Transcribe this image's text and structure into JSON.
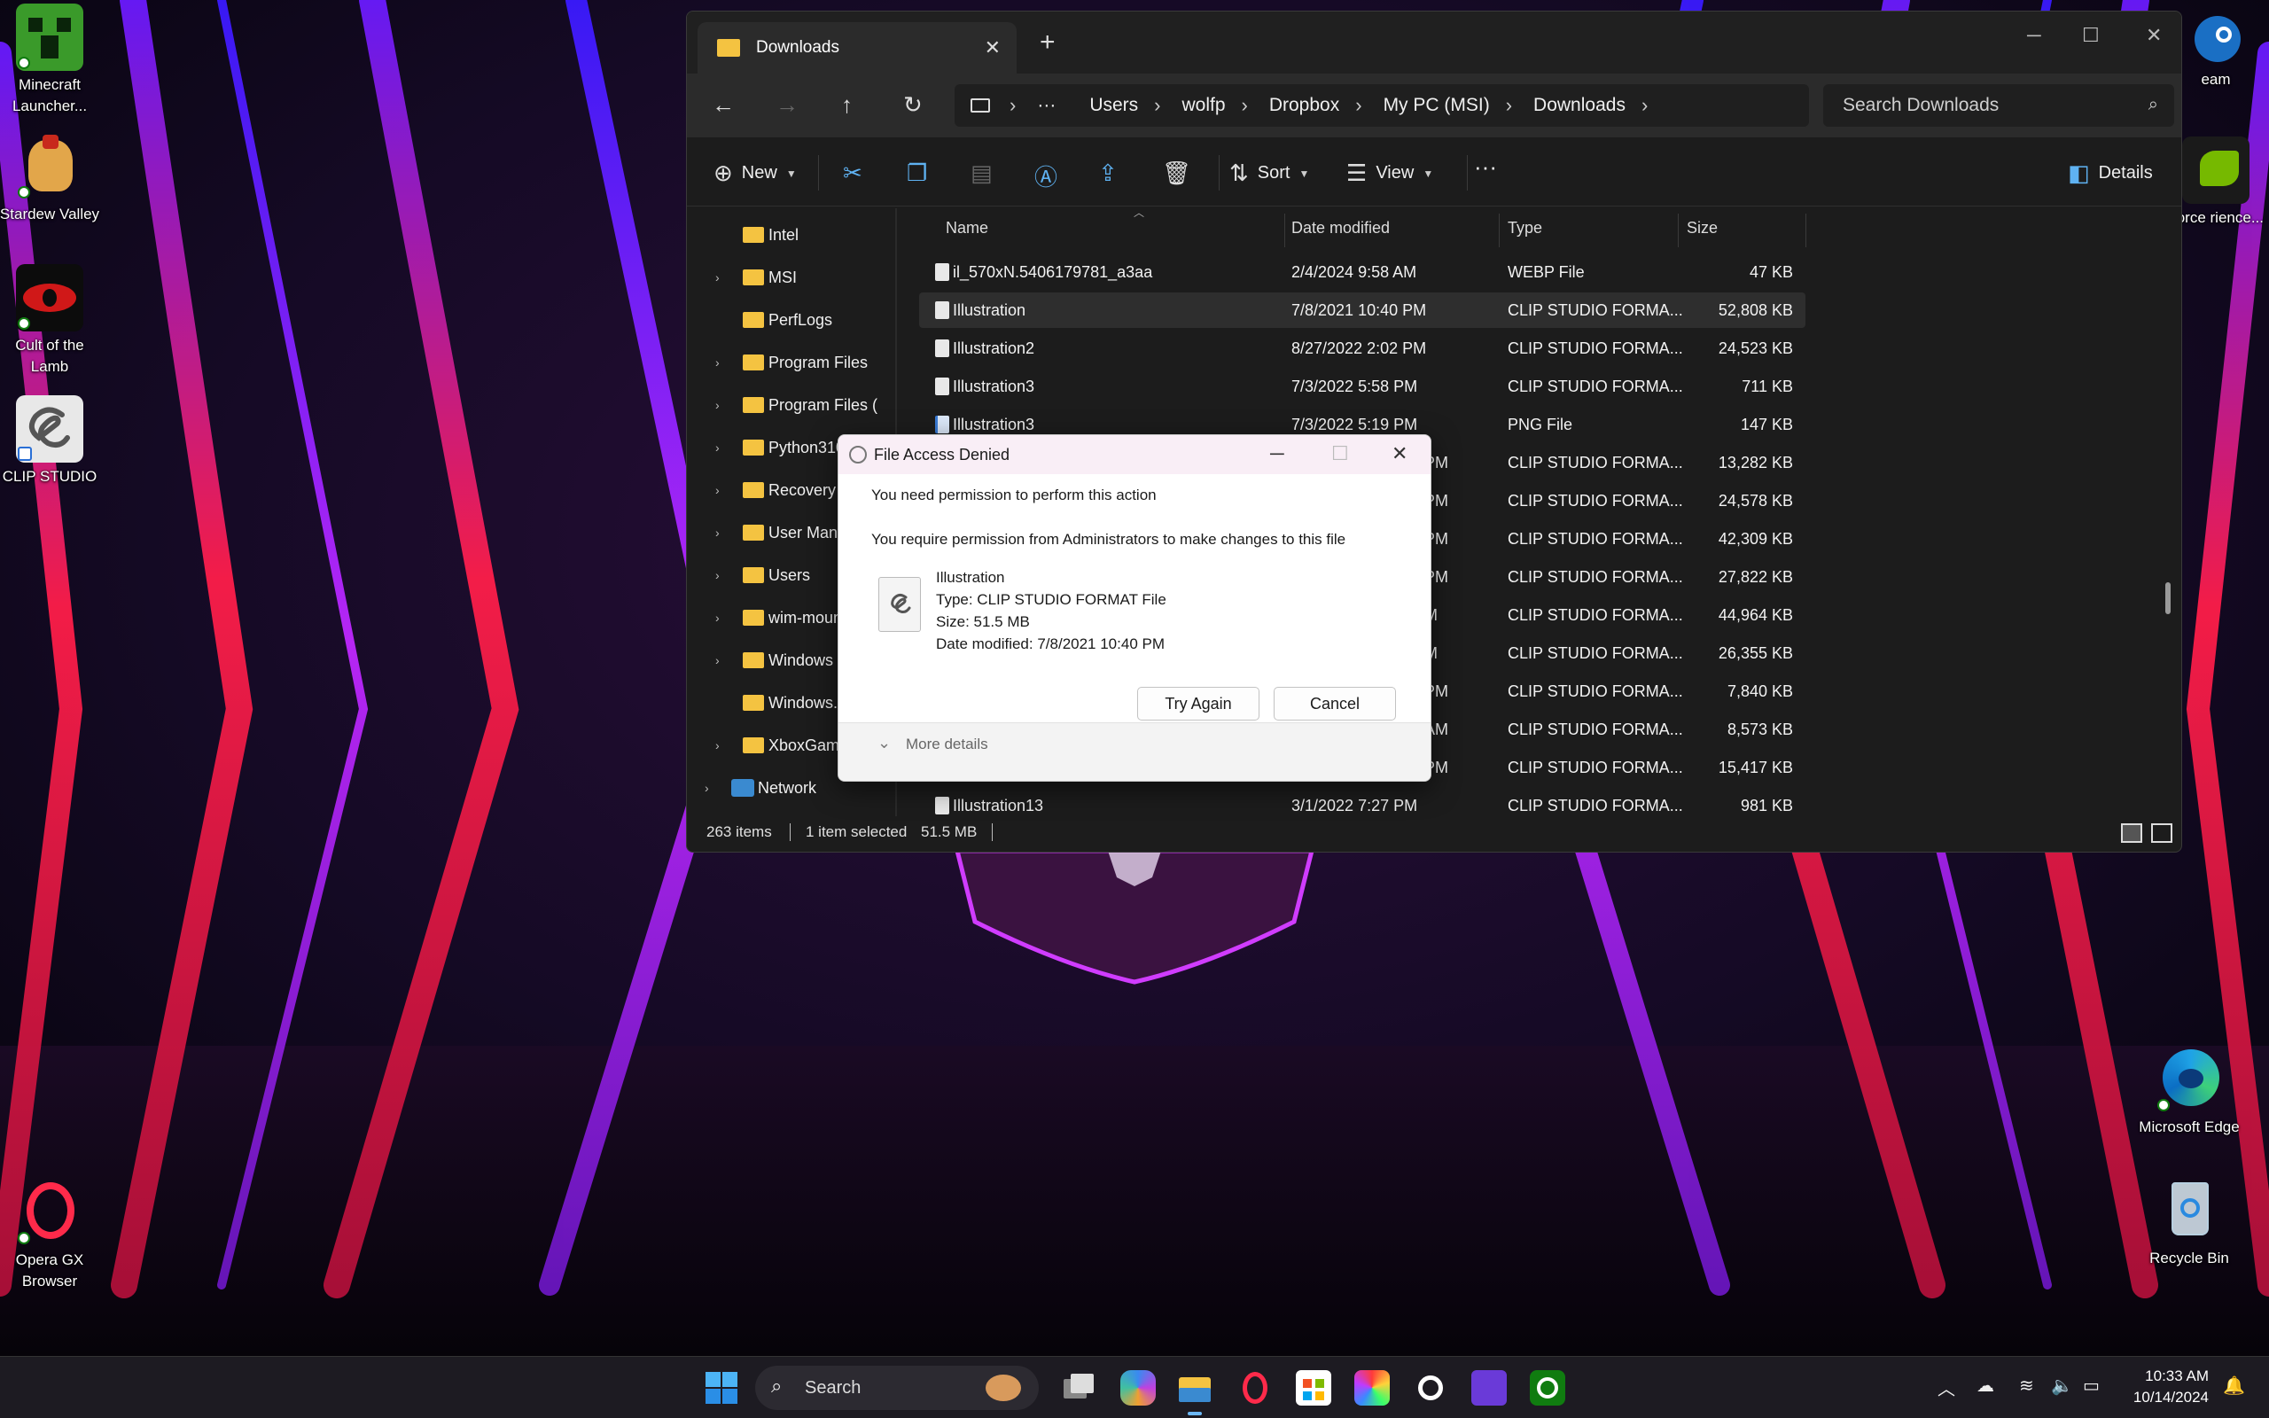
{
  "desktop": {
    "left_icons": [
      {
        "label": "Minecraft Launcher..."
      },
      {
        "label": "Stardew Valley"
      },
      {
        "label": "Cult of the Lamb"
      },
      {
        "label": "CLIP STUDIO"
      },
      {
        "label": "Opera GX Browser"
      }
    ],
    "right_icons": [
      {
        "label": "eam"
      },
      {
        "label": "Force rience..."
      },
      {
        "label": "Microsoft Edge"
      },
      {
        "label": "Recycle Bin"
      }
    ]
  },
  "explorer": {
    "tab_title": "Downloads",
    "new_tab": "+",
    "breadcrumb": [
      "Users",
      "wolfp",
      "Dropbox",
      "My PC (MSI)",
      "Downloads"
    ],
    "breadcrumb_more": "···",
    "search_placeholder": "Search Downloads",
    "toolbar": {
      "new": "New",
      "sort": "Sort",
      "view": "View",
      "more": "···",
      "details": "Details"
    },
    "nav_items": [
      {
        "label": "Intel",
        "expandable": false
      },
      {
        "label": "MSI",
        "expandable": true
      },
      {
        "label": "PerfLogs",
        "expandable": false
      },
      {
        "label": "Program Files",
        "expandable": true
      },
      {
        "label": "Program Files (",
        "expandable": true
      },
      {
        "label": "Python310",
        "expandable": true
      },
      {
        "label": "Recovery",
        "expandable": true
      },
      {
        "label": "User Manuals",
        "expandable": true
      },
      {
        "label": "Users",
        "expandable": true
      },
      {
        "label": "wim-mount",
        "expandable": true
      },
      {
        "label": "Windows",
        "expandable": true
      },
      {
        "label": "Windows.old",
        "expandable": false
      },
      {
        "label": "XboxGames",
        "expandable": true
      },
      {
        "label": "Network",
        "expandable": true
      }
    ],
    "columns": {
      "name": "Name",
      "date": "Date modified",
      "type": "Type",
      "size": "Size"
    },
    "rows": [
      {
        "name": "il_570xN.5406179781_a3aa",
        "date": "2/4/2024 9:58 AM",
        "type": "WEBP File",
        "size": "47 KB"
      },
      {
        "name": "Illustration",
        "date": "7/8/2021 10:40 PM",
        "type": "CLIP STUDIO FORMA...",
        "size": "52,808 KB",
        "selected": true
      },
      {
        "name": "Illustration2",
        "date": "8/27/2022 2:02 PM",
        "type": "CLIP STUDIO FORMA...",
        "size": "24,523 KB"
      },
      {
        "name": "Illustration3",
        "date": "7/3/2022 5:58 PM",
        "type": "CLIP STUDIO FORMA...",
        "size": "711 KB"
      },
      {
        "name": "Illustration3",
        "date": "7/3/2022 5:19 PM",
        "type": "PNG File",
        "size": "147 KB"
      },
      {
        "name": "",
        "date": "PM",
        "type": "CLIP STUDIO FORMA...",
        "size": "13,282 KB"
      },
      {
        "name": "",
        "date": "PM",
        "type": "CLIP STUDIO FORMA...",
        "size": "24,578 KB"
      },
      {
        "name": "",
        "date": "PM",
        "type": "CLIP STUDIO FORMA...",
        "size": "42,309 KB"
      },
      {
        "name": "",
        "date": "PM",
        "type": "CLIP STUDIO FORMA...",
        "size": "27,822 KB"
      },
      {
        "name": "",
        "date": "M",
        "type": "CLIP STUDIO FORMA...",
        "size": "44,964 KB"
      },
      {
        "name": "",
        "date": "M",
        "type": "CLIP STUDIO FORMA...",
        "size": "26,355 KB"
      },
      {
        "name": "",
        "date": "PM",
        "type": "CLIP STUDIO FORMA...",
        "size": "7,840 KB"
      },
      {
        "name": "",
        "date": "AM",
        "type": "CLIP STUDIO FORMA...",
        "size": "8,573 KB"
      },
      {
        "name": "",
        "date": "PM",
        "type": "CLIP STUDIO FORMA...",
        "size": "15,417 KB"
      },
      {
        "name": "Illustration13",
        "date": "3/1/2022 7:27 PM",
        "type": "CLIP STUDIO FORMA...",
        "size": "981 KB"
      }
    ],
    "status": {
      "count": "263 items",
      "selected": "1 item selected",
      "selected_size": "51.5 MB"
    }
  },
  "dialog": {
    "title": "File Access Denied",
    "message1": "You need permission to perform this action",
    "message2": "You require permission from Administrators to make changes to this file",
    "file_name": "Illustration",
    "file_type": "Type: CLIP STUDIO FORMAT File",
    "file_size": "Size: 51.5 MB",
    "file_date": "Date modified: 7/8/2021 10:40 PM",
    "try_again": "Try Again",
    "cancel": "Cancel",
    "more_details": "More details"
  },
  "taskbar": {
    "search_label": "Search",
    "time": "10:33 AM",
    "date": "10/14/2024"
  },
  "colors": {
    "accent": "#5fb2f2",
    "folder": "#f4c341",
    "explorer_bg": "#1c1c1c",
    "dialog_title_bg": "#f9eef6"
  }
}
